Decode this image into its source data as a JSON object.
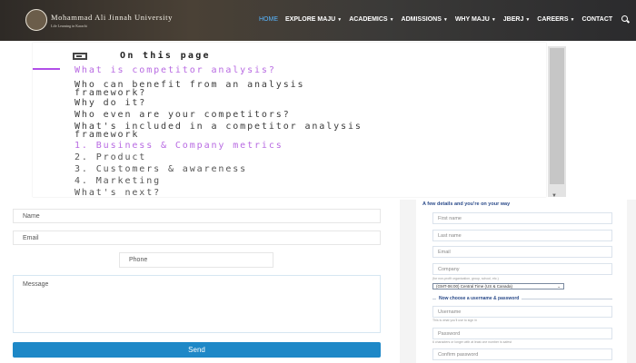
{
  "header": {
    "logo_name": "Mohammad Ali Jinnah University",
    "logo_subtitle": "Life Learning in Karachi",
    "nav": [
      {
        "label": "HOME",
        "dropdown": false,
        "active": true
      },
      {
        "label": "EXPLORE MAJU",
        "dropdown": true
      },
      {
        "label": "ACADEMICS",
        "dropdown": true
      },
      {
        "label": "ADMISSIONS",
        "dropdown": true
      },
      {
        "label": "WHY MAJU",
        "dropdown": true
      },
      {
        "label": "JBERJ",
        "dropdown": true
      },
      {
        "label": "CAREERS",
        "dropdown": true
      },
      {
        "label": "CONTACT",
        "dropdown": false
      }
    ],
    "search_icon": "search-icon",
    "active_color": "#58b6ff"
  },
  "toc": {
    "title": "On this page",
    "items": [
      "What is competitor analysis?",
      "Who can benefit from an analysis\nframework?",
      "Why do it?",
      "Who even are your competitors?",
      "What's included in a competitor analysis\nframework",
      "1. Business & Company metrics",
      "2. Product",
      "3. Customers & awareness",
      "4. Marketing",
      "What's next?"
    ],
    "accent_color": "#b14ee8"
  },
  "contact_form": {
    "name_placeholder": "Name",
    "email_placeholder": "Email",
    "phone_placeholder": "Phone",
    "message_placeholder": "Message",
    "send_label": "Send",
    "button_color": "#1e88c7"
  },
  "signup_form": {
    "title": "A few details and you're on your way",
    "first_name": "First name",
    "last_name": "Last name",
    "email": "Email",
    "company": "Company",
    "company_hint": "(for non-profit organization, group, school, etc.)",
    "timezone": "(GMT-06:00) Central Time (US & Canada)",
    "username_section": "Now choose a username & password",
    "username": "Username",
    "username_hint": "This is what you'll use to sign in",
    "password": "Password",
    "password_hint": "6 characters or longer with at least one number is safest",
    "confirm_password": "Confirm password"
  }
}
